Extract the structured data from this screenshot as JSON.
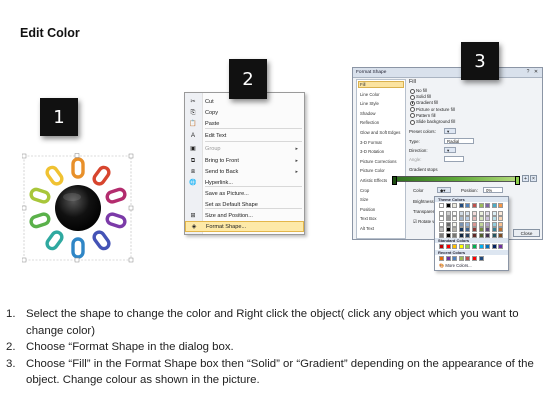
{
  "title": "Edit Color",
  "steps_badges": [
    "1",
    "2",
    "3"
  ],
  "context_menu": {
    "items": [
      {
        "icon": "cut-icon",
        "label": "Cut",
        "submenu": false,
        "disabled": false
      },
      {
        "icon": "copy-icon",
        "label": "Copy",
        "submenu": false,
        "disabled": false
      },
      {
        "icon": "paste-icon",
        "label": "Paste",
        "submenu": false,
        "disabled": false
      },
      {
        "icon": "edit-text-icon",
        "label": "Edit Text",
        "submenu": false,
        "disabled": false
      },
      {
        "icon": "group-icon",
        "label": "Group",
        "submenu": true,
        "disabled": true
      },
      {
        "icon": "bring-to-front-icon",
        "label": "Bring to Front",
        "submenu": true,
        "disabled": false
      },
      {
        "icon": "send-to-back-icon",
        "label": "Send to Back",
        "submenu": true,
        "disabled": false
      },
      {
        "icon": "hyperlink-icon",
        "label": "Hyperlink...",
        "submenu": false,
        "disabled": false
      },
      {
        "icon": "",
        "label": "Save as Picture...",
        "submenu": false,
        "disabled": false
      },
      {
        "icon": "",
        "label": "Set as Default Shape",
        "submenu": false,
        "disabled": false
      },
      {
        "icon": "size-position-icon",
        "label": "Size and Position...",
        "submenu": false,
        "disabled": false
      },
      {
        "icon": "format-shape-icon",
        "label": "Format Shape...",
        "submenu": false,
        "disabled": false,
        "highlighted": true
      }
    ]
  },
  "dialog": {
    "title": "Format Shape",
    "nav_items": [
      "Fill",
      "Line Color",
      "Line Style",
      "Shadow",
      "Reflection",
      "Glow and Soft Edges",
      "3-D Format",
      "3-D Rotation",
      "Picture Corrections",
      "Picture Color",
      "Artistic Effects",
      "Crop",
      "Size",
      "Position",
      "Text Box",
      "Alt Text"
    ],
    "selected_nav": "Fill",
    "fill_heading": "Fill",
    "fill_options": [
      {
        "label": "No fill",
        "selected": false
      },
      {
        "label": "Solid fill",
        "selected": false
      },
      {
        "label": "Gradient fill",
        "selected": true
      },
      {
        "label": "Picture or texture fill",
        "selected": false
      },
      {
        "label": "Pattern fill",
        "selected": false
      },
      {
        "label": "Slide background fill",
        "selected": false
      }
    ],
    "preset_colors_label": "Preset colors:",
    "type_label": "Type:",
    "type_value": "Radial",
    "direction_label": "Direction:",
    "angle_label": "Angle:",
    "gradient_stops_label": "Gradient stops",
    "color_label": "Color",
    "position_label": "Position:",
    "position_value": "0%",
    "brightness_label": "Brightness:",
    "transparency_label": "Transparency:",
    "rotate_label": "Rotate with shape",
    "close_label": "Close"
  },
  "color_popup": {
    "theme_colors_label": "Theme Colors",
    "standard_colors_label": "Standard Colors",
    "recent_colors_label": "Recent Colors",
    "more_colors_label": "More Colors...",
    "theme_top": [
      "#ffffff",
      "#000000",
      "#eeece1",
      "#1f497d",
      "#4f81bd",
      "#c0504d",
      "#9bbb59",
      "#8064a2",
      "#4bacc6",
      "#f79646"
    ],
    "standard": [
      "#c00000",
      "#ff0000",
      "#ffc000",
      "#ffff00",
      "#92d050",
      "#00b050",
      "#00b0f0",
      "#0070c0",
      "#002060",
      "#7030a0"
    ],
    "recent": [
      "#e46c0a",
      "#7030a0",
      "#4f81bd",
      "#9bbb59",
      "#c0504d",
      "#ff0000",
      "#1f497d"
    ]
  },
  "instructions": [
    {
      "num": "1.",
      "text": "Select the shape to change the color and Right click the object( click any object which you want to change color)"
    },
    {
      "num": "2.",
      "text": "Choose “Format Shape in the dialog box."
    },
    {
      "num": "3.",
      "text": "Choose “Fill” in the Format Shape box then “Solid” or “Gradient” depending on the appearance of the object. Change colour as shown in the picture."
    }
  ],
  "chain_colors": [
    "#e8902a",
    "#d7452e",
    "#b32c6e",
    "#7b3aa8",
    "#4453b6",
    "#2f86c6",
    "#2fa9a0",
    "#5ab14a",
    "#a8c63a",
    "#f0c232"
  ]
}
